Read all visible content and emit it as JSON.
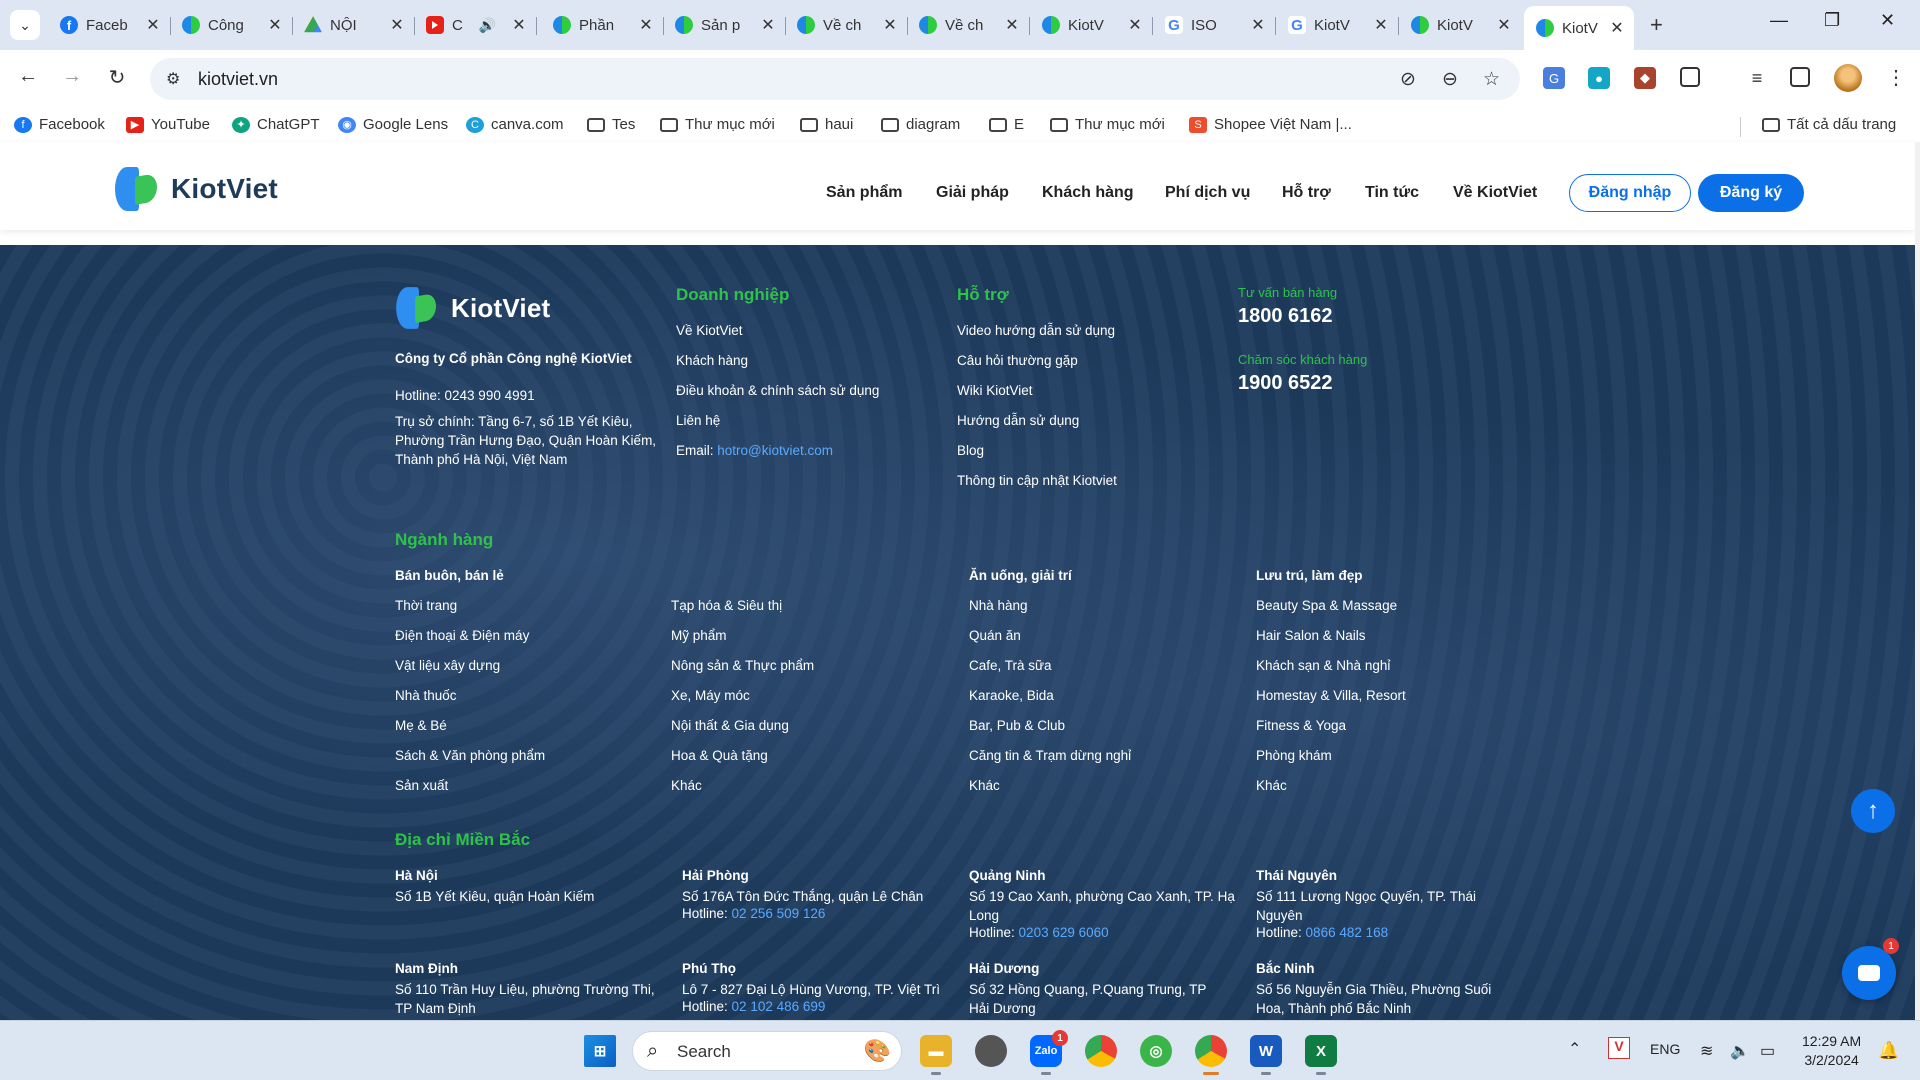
{
  "browser": {
    "tabs": [
      {
        "title": "Faceb",
        "icon": "facebook-icon"
      },
      {
        "title": "Công",
        "icon": "kiotviet-icon"
      },
      {
        "title": "NỘI",
        "icon": "google-drive-icon"
      },
      {
        "title": "C",
        "icon": "youtube-icon"
      },
      {
        "title": "Phần",
        "icon": "kiotviet-icon"
      },
      {
        "title": "Sản p",
        "icon": "kiotviet-icon"
      },
      {
        "title": "Về ch",
        "icon": "kiotviet-icon"
      },
      {
        "title": "Về ch",
        "icon": "kiotviet-icon"
      },
      {
        "title": "KiotV",
        "icon": "kiotviet-icon"
      },
      {
        "title": "ISO",
        "icon": "google-icon"
      },
      {
        "title": "KiotV",
        "icon": "google-icon"
      },
      {
        "title": "KiotV",
        "icon": "kiotviet-icon"
      },
      {
        "title": "KiotV",
        "icon": "kiotviet-icon",
        "active": true
      }
    ],
    "url": "kiotviet.vn",
    "bookmarks": [
      {
        "label": "Facebook",
        "icon": "facebook-icon"
      },
      {
        "label": "YouTube",
        "icon": "youtube-icon"
      },
      {
        "label": "ChatGPT",
        "icon": "chatgpt-icon"
      },
      {
        "label": "Google Lens",
        "icon": "google-lens-icon"
      },
      {
        "label": "canva.com",
        "icon": "canva-icon"
      },
      {
        "label": "Tes",
        "icon": "folder-icon"
      },
      {
        "label": "Thư mục mới",
        "icon": "folder-icon"
      },
      {
        "label": "haui",
        "icon": "folder-icon"
      },
      {
        "label": "diagram",
        "icon": "folder-icon"
      },
      {
        "label": "E",
        "icon": "folder-icon"
      },
      {
        "label": "Thư mục mới",
        "icon": "folder-icon"
      },
      {
        "label": "Shopee Việt Nam |...",
        "icon": "shopee-icon"
      }
    ],
    "all_bookmarks": "Tất cả dấu trang"
  },
  "site": {
    "brand": "KiotViet",
    "nav": [
      "Sản phẩm",
      "Giải pháp",
      "Khách hàng",
      "Phí dịch vụ",
      "Hỗ trợ",
      "Tin tức",
      "Về KiotViet"
    ],
    "login": "Đăng nhập",
    "signup": "Đăng ký"
  },
  "footer": {
    "company": "Công ty Cổ phần Công nghệ KiotViet",
    "hotline": "Hotline: 0243 990 4991",
    "address_lines": [
      "Trụ sở chính: Tầng 6-7, số 1B Yết Kiêu,",
      "Phường Trần Hưng Đạo, Quận Hoàn Kiếm,",
      "Thành phố Hà Nội, Việt Nam"
    ],
    "business": {
      "heading": "Doanh nghiệp",
      "links": [
        "Về KiotViet",
        "Khách hàng",
        "Điều khoản & chính sách sử dụng",
        "Liên hệ"
      ],
      "email_label": "Email:",
      "email": "hotro@kiotviet.com"
    },
    "support": {
      "heading": "Hỗ trợ",
      "links": [
        "Video hướng dẫn sử dụng",
        "Câu hỏi thường gặp",
        "Wiki KiotViet",
        "Hướng dẫn sử dụng",
        "Blog",
        "Thông tin cập nhật Kiotviet"
      ]
    },
    "contact": {
      "sales_label": "Tư vấn bán hàng",
      "sales_phone": "1800 6162",
      "care_label": "Chăm sóc khách hàng",
      "care_phone": "1900 6522"
    },
    "industries": {
      "heading": "Ngành hàng",
      "col1": {
        "title": "Bán buôn, bán lẻ",
        "items": [
          "Thời trang",
          "Điện thoại & Điện máy",
          "Vật liệu xây dựng",
          "Nhà thuốc",
          "Mẹ & Bé",
          "Sách & Văn phòng phẩm",
          "Sản xuất"
        ]
      },
      "col2": {
        "items": [
          "Tạp hóa & Siêu thị",
          "Mỹ phẩm",
          "Nông sản & Thực phẩm",
          "Xe, Máy móc",
          "Nội thất & Gia dụng",
          "Hoa & Quà tặng",
          "Khác"
        ]
      },
      "col3": {
        "title": "Ăn uống, giải trí",
        "items": [
          "Nhà hàng",
          "Quán ăn",
          "Cafe, Trà sữa",
          "Karaoke, Bida",
          "Bar, Pub & Club",
          "Căng tin & Trạm dừng nghỉ",
          "Khác"
        ]
      },
      "col4": {
        "title": "Lưu trú, làm đẹp",
        "items": [
          "Beauty Spa & Massage",
          "Hair Salon & Nails",
          "Khách sạn & Nhà nghỉ",
          "Homestay & Villa, Resort",
          "Fitness & Yoga",
          "Phòng khám",
          "Khác"
        ]
      }
    },
    "north": {
      "heading": "Địa chỉ Miền Bắc",
      "hotline_label": "Hotline:",
      "offices": [
        {
          "city": "Hà Nội",
          "address": "Số 1B Yết Kiêu, quận Hoàn Kiếm",
          "phone": ""
        },
        {
          "city": "Hải Phòng",
          "address": "Số 176A Tôn Đức Thắng, quận Lê Chân",
          "phone": "02 256 509 126"
        },
        {
          "city": "Quảng Ninh",
          "address": "Số 19 Cao Xanh, phường Cao Xanh, TP. Hạ Long",
          "phone": "0203 629 6060"
        },
        {
          "city": "Thái Nguyên",
          "address": "Số 111 Lương Ngọc Quyến, TP. Thái Nguyên",
          "phone": "0866 482 168"
        },
        {
          "city": "Nam Định",
          "address": "Số 110 Trần Huy Liệu, phường Trường Thi, TP Nam Định",
          "phone": ""
        },
        {
          "city": "Phú Thọ",
          "address": "Lô 7 - 827 Đại Lộ Hùng Vương, TP. Việt Trì",
          "phone": "02 102 486 699"
        },
        {
          "city": "Hải Dương",
          "address": "Số 32 Hồng Quang, P.Quang Trung, TP Hải Dương",
          "phone": ""
        },
        {
          "city": "Bắc Ninh",
          "address": "Số 56 Nguyễn Gia Thiều, Phường Suối Hoa, Thành phố Bắc Ninh",
          "phone": ""
        }
      ]
    }
  },
  "widgets": {
    "chat_badge": "1",
    "scroll_top_icon": "arrow-up-icon"
  },
  "taskbar": {
    "search_label": "Search",
    "zalo_badge": "1",
    "lang": "ENG",
    "time": "12:29 AM",
    "date": "3/2/2024"
  }
}
